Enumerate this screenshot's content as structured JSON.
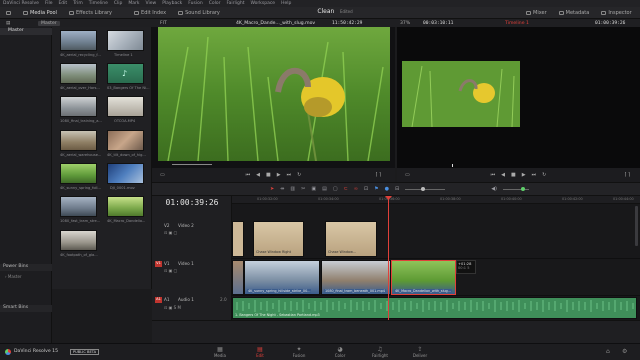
{
  "menu": [
    "DaVinci Resolve",
    "File",
    "Edit",
    "Trim",
    "Timeline",
    "Clip",
    "Mark",
    "View",
    "Playback",
    "Fusion",
    "Color",
    "Fairlight",
    "Workspace",
    "Help"
  ],
  "toolbar": {
    "media_pool": "Media Pool",
    "effects_library": "Effects Library",
    "edit_index": "Edit Index",
    "sound_library": "Sound Library",
    "layout_title": "Clean",
    "layout_sub": "Edited",
    "mixer": "Mixer",
    "metadata": "Metadata",
    "inspector": "Inspector"
  },
  "viewerbar": {
    "fit": "FIT",
    "clip_name": "4K_Macro_Dande..._with_slug.mov",
    "source_tc": "11:50:42:29",
    "zoom": "37%",
    "duration_tc": "00:03:10:11",
    "timeline_name": "Timeline 1",
    "timeline_tc": "01:00:39:26"
  },
  "left": {
    "master": "Master",
    "power_bins": "Power Bins",
    "master_sub": "Master",
    "smart_bins": "Smart Bins"
  },
  "media": [
    {
      "label": "4K_aerial_recycling_f..."
    },
    {
      "label": "Timeline 1"
    },
    {
      "label": "4K_aerial_over_Hors..."
    },
    {
      "label": "03_Bangers Of The Ni..."
    },
    {
      "label": "1080_final_training_a..."
    },
    {
      "label": "OTCOA.MP4"
    },
    {
      "label": "4K_aerial_warehouse..."
    },
    {
      "label": "4K_tilt_down_of_hig..."
    },
    {
      "label": "4K_sunny_spring_foll..."
    },
    {
      "label": "DJI_0001.mov"
    },
    {
      "label": "1080_fast_tram_stre..."
    },
    {
      "label": "4K_Macro_Dandelio..."
    },
    {
      "label": "4K_footpath_of_gla..."
    }
  ],
  "timeline": {
    "timecode": "01:00:39:26",
    "tracks": [
      {
        "id": "V2",
        "name": "Video 2"
      },
      {
        "id": "V1",
        "name": "Video 1"
      },
      {
        "id": "A1",
        "name": "Audio 1",
        "level": "2.0"
      }
    ],
    "ruler": [
      "01:00:32:00",
      "01:00:34:00",
      "01:00:36:00",
      "01:00:38:00",
      "01:00:40:00",
      "01:00:42:00",
      "01:00:44:00"
    ],
    "clips_v2": [
      "Chase Window Right",
      "Chase Window..."
    ],
    "clips_v1": [
      "4K_sunny_spring_hillside_strike_00...",
      "1080_final_tram_beneath_001.mp4",
      "4K_Macro_Dandelion_with_slug..."
    ],
    "clip_audio": "1. Bangers Of The Night - Sebastian Portland.mp3",
    "trim_tooltip_1": "+01:28",
    "trim_tooltip_2": "00:1 5"
  },
  "pages": [
    "Media",
    "Edit",
    "Fusion",
    "Color",
    "Fairlight",
    "Deliver"
  ],
  "active_page": "Edit",
  "app": {
    "name": "DaVinci Resolve 15",
    "badge": "PUBLIC BETA"
  },
  "colors": {
    "accent_red": "#e0403a",
    "timeline_bg": "#18181a",
    "video_clip": "#3b5c8c",
    "audio_clip": "#3f8f5a"
  }
}
